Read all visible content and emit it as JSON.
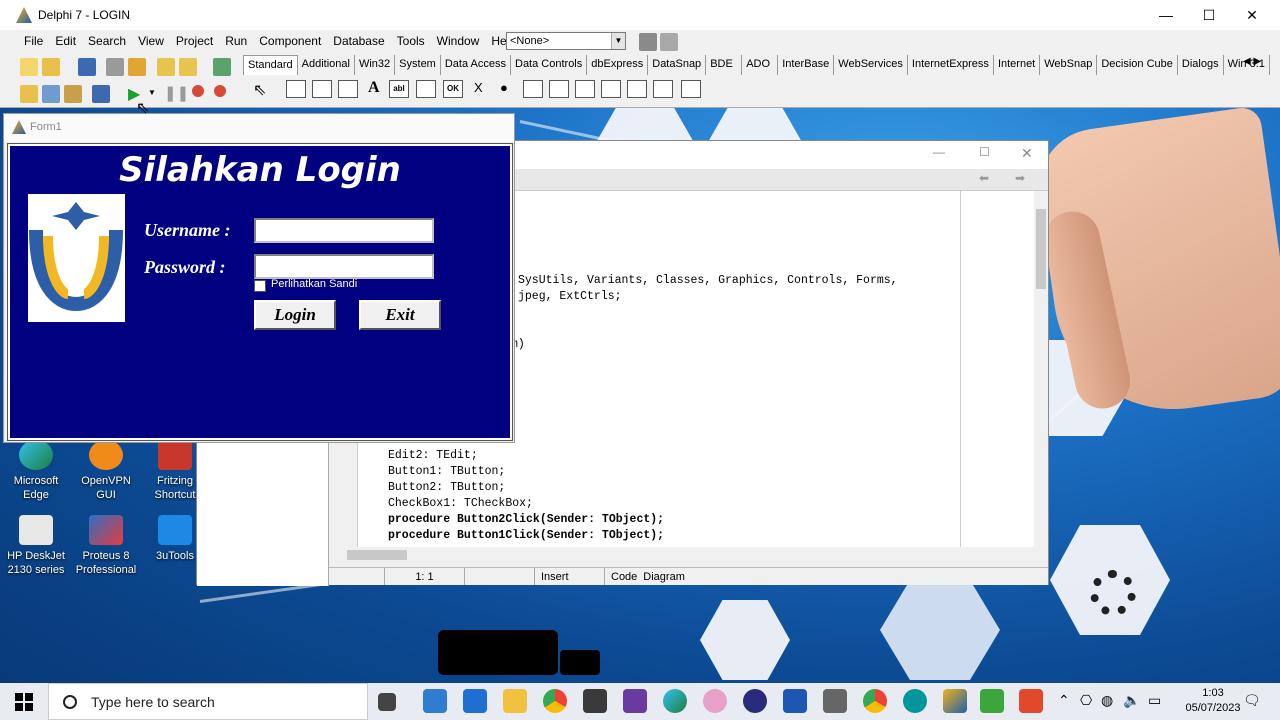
{
  "ide": {
    "title": "Delphi 7 - LOGIN",
    "menu": [
      "File",
      "Edit",
      "Search",
      "View",
      "Project",
      "Run",
      "Component",
      "Database",
      "Tools",
      "Window",
      "Help"
    ],
    "combo_value": "<None>",
    "palette_tabs": [
      "Standard",
      "Additional",
      "Win32",
      "System",
      "Data Access",
      "Data Controls",
      "dbExpress",
      "DataSnap",
      "BDE",
      "ADO",
      "InterBase",
      "WebServices",
      "InternetExpress",
      "Internet",
      "WebSnap",
      "Decision Cube",
      "Dialogs",
      "Win 3.1"
    ],
    "palette_icons": [
      "A",
      "abl",
      "OK",
      "X",
      "●"
    ]
  },
  "editor": {
    "code_lines": [
      "SysUtils, Variants, Classes, Graphics, Controls, Forms,",
      "jpeg, ExtCtrls;",
      "m)",
      "Edit2: TEdit;",
      "Button1: TButton;",
      "Button2: TButton;",
      "CheckBox1: TCheckBox;",
      "procedure Button2Click(Sender: TObject);",
      "procedure Button1Click(Sender: TObject);"
    ],
    "status": {
      "position": "1:  1",
      "mode": "Insert",
      "tab_code": "Code",
      "tab_diagram": "Diagram"
    }
  },
  "form1": {
    "title": "Form1",
    "heading": "Silahkan Login",
    "username_label": "Username :",
    "password_label": "Password :",
    "username_value": "",
    "password_value": "",
    "show_password_label": "Perlihatkan Sandi",
    "login_button": "Login",
    "exit_button": "Exit"
  },
  "desktop_icons": [
    {
      "label": "Microsoft Edge"
    },
    {
      "label": "OpenVPN GUI"
    },
    {
      "label": "Fritzing Shortcut"
    },
    {
      "label": "HP DeskJet 2130 series"
    },
    {
      "label": "Proteus 8 Professional"
    },
    {
      "label": "3uTools"
    }
  ],
  "taskbar": {
    "search_placeholder": "Type here to search",
    "time": "1:03",
    "date": "05/07/2023"
  },
  "colors": {
    "login_panel": "#000080",
    "desktop": "#1b6fc4"
  }
}
